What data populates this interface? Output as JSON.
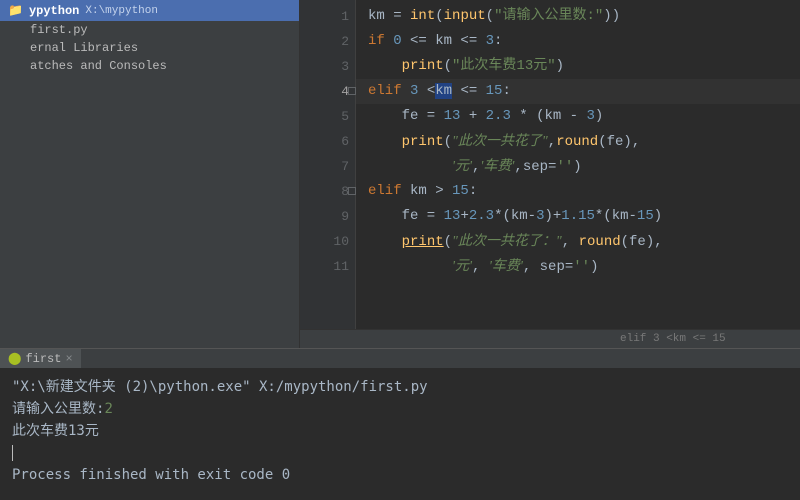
{
  "colors": {
    "accent": "#4b6eaf",
    "keyword": "#cc7832",
    "string": "#6a8759",
    "number": "#6897bb",
    "function": "#ffc66d"
  },
  "project": {
    "name": "ypython",
    "path": "X:\\mypython",
    "tree": [
      {
        "label": "first.py",
        "icon": "python-file"
      },
      {
        "label": "ernal Libraries",
        "icon": "library"
      },
      {
        "label": "atches and Consoles",
        "icon": "scratch"
      }
    ]
  },
  "editor": {
    "current_line": 4,
    "breadcrumb": "elif 3 <km <= 15",
    "lines": [
      {
        "n": 1,
        "tokens": [
          [
            "op",
            "km "
          ],
          [
            "op",
            "= "
          ],
          [
            "fn",
            "int"
          ],
          [
            "op",
            "("
          ],
          [
            "fn",
            "input"
          ],
          [
            "op",
            "("
          ],
          [
            "str",
            "\"请输入公里数:\""
          ],
          [
            "op",
            "))"
          ]
        ]
      },
      {
        "n": 2,
        "tokens": [
          [
            "kw",
            "if "
          ],
          [
            "num",
            "0"
          ],
          [
            "op",
            " <= km <= "
          ],
          [
            "num",
            "3"
          ],
          [
            "op",
            ":"
          ]
        ]
      },
      {
        "n": 3,
        "tokens": [
          [
            "op",
            "    "
          ],
          [
            "fn",
            "print"
          ],
          [
            "op",
            "("
          ],
          [
            "str",
            "\"此次车费13元\""
          ],
          [
            "op",
            ")"
          ]
        ]
      },
      {
        "n": 4,
        "tokens": [
          [
            "kw",
            "elif "
          ],
          [
            "num",
            "3"
          ],
          [
            "op",
            " <"
          ],
          [
            "hl",
            "km"
          ],
          [
            "op",
            " <= "
          ],
          [
            "num",
            "15"
          ],
          [
            "op",
            ":"
          ]
        ],
        "fold": true
      },
      {
        "n": 5,
        "tokens": [
          [
            "op",
            "    fe = "
          ],
          [
            "num",
            "13"
          ],
          [
            "op",
            " + "
          ],
          [
            "num",
            "2.3"
          ],
          [
            "op",
            " * (km - "
          ],
          [
            "num",
            "3"
          ],
          [
            "op",
            ")"
          ]
        ]
      },
      {
        "n": 6,
        "tokens": [
          [
            "op",
            "    "
          ],
          [
            "fn",
            "print"
          ],
          [
            "op",
            "("
          ],
          [
            "str-it",
            "\"此次一共花了\""
          ],
          [
            "op",
            ","
          ],
          [
            "fn",
            "round"
          ],
          [
            "op",
            "(fe),"
          ]
        ]
      },
      {
        "n": 7,
        "tokens": [
          [
            "op",
            "          "
          ],
          [
            "str-it",
            "'元'"
          ],
          [
            "op",
            ","
          ],
          [
            "str-it",
            "'车费'"
          ],
          [
            "op",
            ","
          ],
          [
            "op",
            "sep="
          ],
          [
            "str",
            "''"
          ],
          [
            "op",
            ")"
          ]
        ]
      },
      {
        "n": 8,
        "tokens": [
          [
            "kw",
            "elif "
          ],
          [
            "op",
            "km > "
          ],
          [
            "num",
            "15"
          ],
          [
            "op",
            ":"
          ]
        ],
        "fold": true
      },
      {
        "n": 9,
        "tokens": [
          [
            "op",
            "    fe = "
          ],
          [
            "num",
            "13"
          ],
          [
            "op",
            "+"
          ],
          [
            "num",
            "2.3"
          ],
          [
            "op",
            "*(km-"
          ],
          [
            "num",
            "3"
          ],
          [
            "op",
            ")+"
          ],
          [
            "num",
            "1.15"
          ],
          [
            "op",
            "*(km-"
          ],
          [
            "num",
            "15"
          ],
          [
            "op",
            ")"
          ]
        ]
      },
      {
        "n": 10,
        "tokens": [
          [
            "op",
            "    "
          ],
          [
            "fn-ul",
            "print"
          ],
          [
            "op",
            "("
          ],
          [
            "str-it",
            "\"此次一共花了：\""
          ],
          [
            "op",
            ", "
          ],
          [
            "fn",
            "round"
          ],
          [
            "op",
            "(fe),"
          ]
        ]
      },
      {
        "n": 11,
        "tokens": [
          [
            "op",
            "          "
          ],
          [
            "str-it",
            "'元'"
          ],
          [
            "op",
            ", "
          ],
          [
            "str-it",
            "'车费'"
          ],
          [
            "op",
            ", "
          ],
          [
            "op",
            "sep="
          ],
          [
            "str",
            "''"
          ],
          [
            "op",
            ")"
          ]
        ]
      }
    ]
  },
  "run": {
    "tab_label": "first",
    "close": "×",
    "output": [
      {
        "segments": [
          [
            "plain",
            "\"X:\\新建文件夹 (2)\\python.exe\" X:/mypython/first.py"
          ]
        ]
      },
      {
        "segments": [
          [
            "plain",
            "请输入公里数:"
          ],
          [
            "input",
            "2"
          ]
        ]
      },
      {
        "segments": [
          [
            "plain",
            "此次车费13元"
          ]
        ]
      },
      {
        "cursor": true
      },
      {
        "segments": [
          [
            "plain",
            "Process finished with exit code 0"
          ]
        ]
      }
    ]
  }
}
